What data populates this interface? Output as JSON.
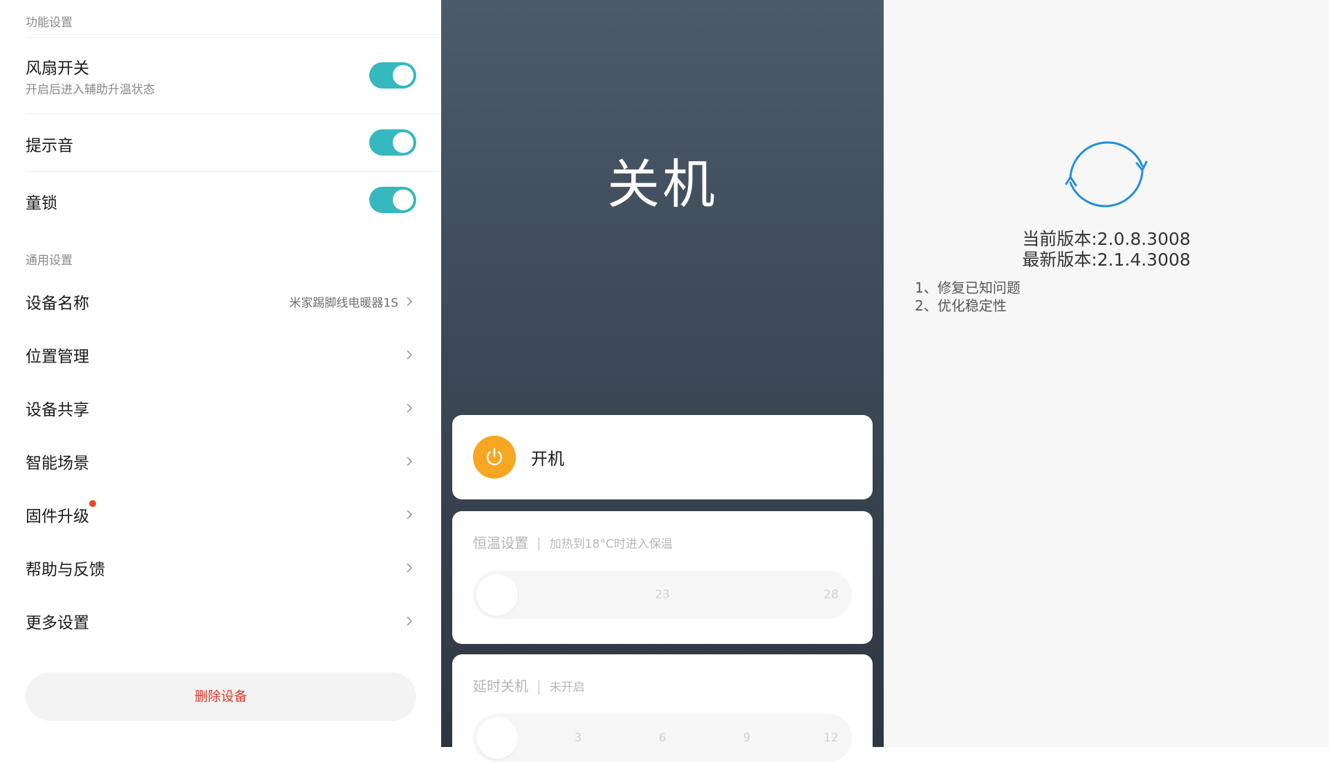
{
  "settings": {
    "function_section_title": "功能设置",
    "fan": {
      "title": "风扇开关",
      "subtitle": "开启后进入辅助升温状态",
      "on": true
    },
    "sound": {
      "title": "提示音",
      "on": true
    },
    "child_lock": {
      "title": "童锁",
      "on": true
    },
    "general_section_title": "通用设置",
    "items": [
      {
        "label": "设备名称",
        "value": "米家踢脚线电暖器1S"
      },
      {
        "label": "位置管理"
      },
      {
        "label": "设备共享"
      },
      {
        "label": "智能场景"
      },
      {
        "label": "固件升级",
        "badge": "red-dot"
      },
      {
        "label": "帮助与反馈"
      },
      {
        "label": "更多设置"
      }
    ],
    "delete_button": "删除设备"
  },
  "control": {
    "status": "关机",
    "power_label": "开机",
    "thermostat": {
      "title": "恒温设置",
      "desc": "加热到18°C时进入保温",
      "ticks": [
        "23",
        "28"
      ]
    },
    "timer": {
      "title": "延时关机",
      "desc": "未开启",
      "ticks": [
        "3",
        "6",
        "9",
        "12"
      ]
    }
  },
  "firmware": {
    "current_version": "当前版本:2.0.8.3008",
    "latest_version": "最新版本:2.1.4.3008",
    "notes": [
      "1、修复已知问题",
      "2、优化稳定性"
    ]
  },
  "colors": {
    "toggle_on": "#35b8be",
    "power_orange": "#f6a623",
    "delete_red": "#e03a2a",
    "refresh_blue": "#1f8de0",
    "badge_red": "#f0481f"
  }
}
